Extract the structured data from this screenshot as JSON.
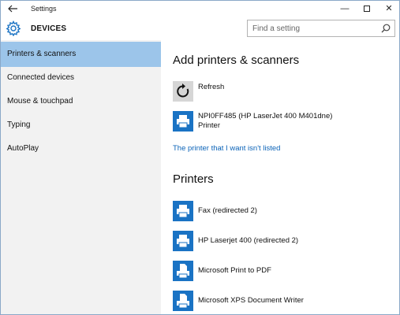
{
  "window": {
    "title": "Settings",
    "controls": {
      "minimize": "—",
      "close": "✕"
    }
  },
  "header": {
    "title": "DEVICES",
    "search_placeholder": "Find a setting"
  },
  "sidebar": {
    "items": [
      {
        "label": "Printers & scanners",
        "active": true
      },
      {
        "label": "Connected devices",
        "active": false
      },
      {
        "label": "Mouse & touchpad",
        "active": false
      },
      {
        "label": "Typing",
        "active": false
      },
      {
        "label": "AutoPlay",
        "active": false
      }
    ]
  },
  "main": {
    "add_section_title": "Add printers & scanners",
    "refresh_label": "Refresh",
    "found_device": {
      "name": "NPI0FF485 (HP LaserJet 400 M401dne)",
      "type": "Printer"
    },
    "missing_link": "The printer that I want isn't listed",
    "printers_title": "Printers",
    "printers": [
      {
        "name": "Fax (redirected 2)",
        "icon": "printer-icon"
      },
      {
        "name": "HP Laserjet 400 (redirected 2)",
        "icon": "printer-icon"
      },
      {
        "name": "Microsoft Print to PDF",
        "icon": "document-printer-icon"
      },
      {
        "name": "Microsoft XPS Document Writer",
        "icon": "document-printer-icon"
      }
    ]
  },
  "colors": {
    "accent": "#1a73c4",
    "sidebar_bg": "#f2f2f2",
    "sidebar_active": "#9cc5ea",
    "link": "#0b63b8"
  }
}
